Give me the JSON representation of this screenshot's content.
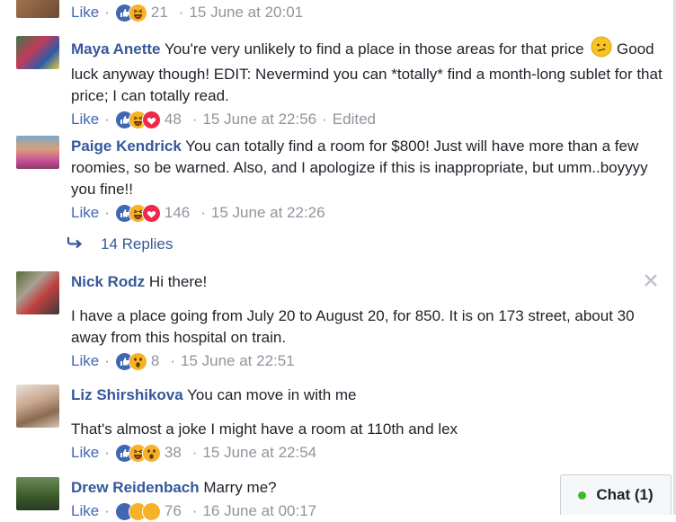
{
  "colors": {
    "link": "#365899",
    "like": "#4267b2",
    "muted": "#90949c",
    "online": "#42b72a"
  },
  "top_meta": {
    "like": "Like",
    "count": "21",
    "time": "15 June at 20:01"
  },
  "comments": [
    {
      "name": "Maya Anette",
      "text1": "You're very unlikely to find a place in those areas for that price",
      "text2": " Good luck anyway though! EDIT: Nevermind you can *totally* find a month-long sublet for that price; I can totally read.",
      "like": "Like",
      "count": "48",
      "time": "15 June at 22:56",
      "edited": "Edited",
      "reactions": [
        "like-icon",
        "haha-icon",
        "love-icon"
      ]
    },
    {
      "name": "Paige Kendrick",
      "text1": "You can totally find a room for $800! Just will have more than a few roomies, so be warned. Also, and I apologize if this is inappropriate, but umm..boyyyy you fine!!",
      "like": "Like",
      "count": "146",
      "time": "15 June at 22:26",
      "reactions": [
        "like-icon",
        "haha-icon",
        "love-icon"
      ]
    },
    {
      "name": "Nick Rodz",
      "text1": "Hi there!",
      "para": "I have a place going from July 20 to August 20, for 850. It is on 173 street, about 30 away from this hospital on train.",
      "like": "Like",
      "count": "8",
      "time": "15 June at 22:51",
      "reactions": [
        "like-icon",
        "wow-icon"
      ]
    },
    {
      "name": "Liz Shirshikova",
      "text1": "You can move in with me",
      "para": "That's almost a joke I might have a room at 110th and lex",
      "like": "Like",
      "count": "38",
      "time": "15 June at 22:54",
      "reactions": [
        "like-icon",
        "haha-icon",
        "wow-icon"
      ]
    },
    {
      "name": "Drew Reidenbach",
      "text1": "Marry me?",
      "like": "Like",
      "count": "76",
      "time": "16 June at 00:17",
      "reactions": [
        "like-icon",
        "haha-icon",
        "wow-icon"
      ]
    }
  ],
  "replies": {
    "label": "14 Replies"
  },
  "chat": {
    "label": "Chat (1)"
  }
}
